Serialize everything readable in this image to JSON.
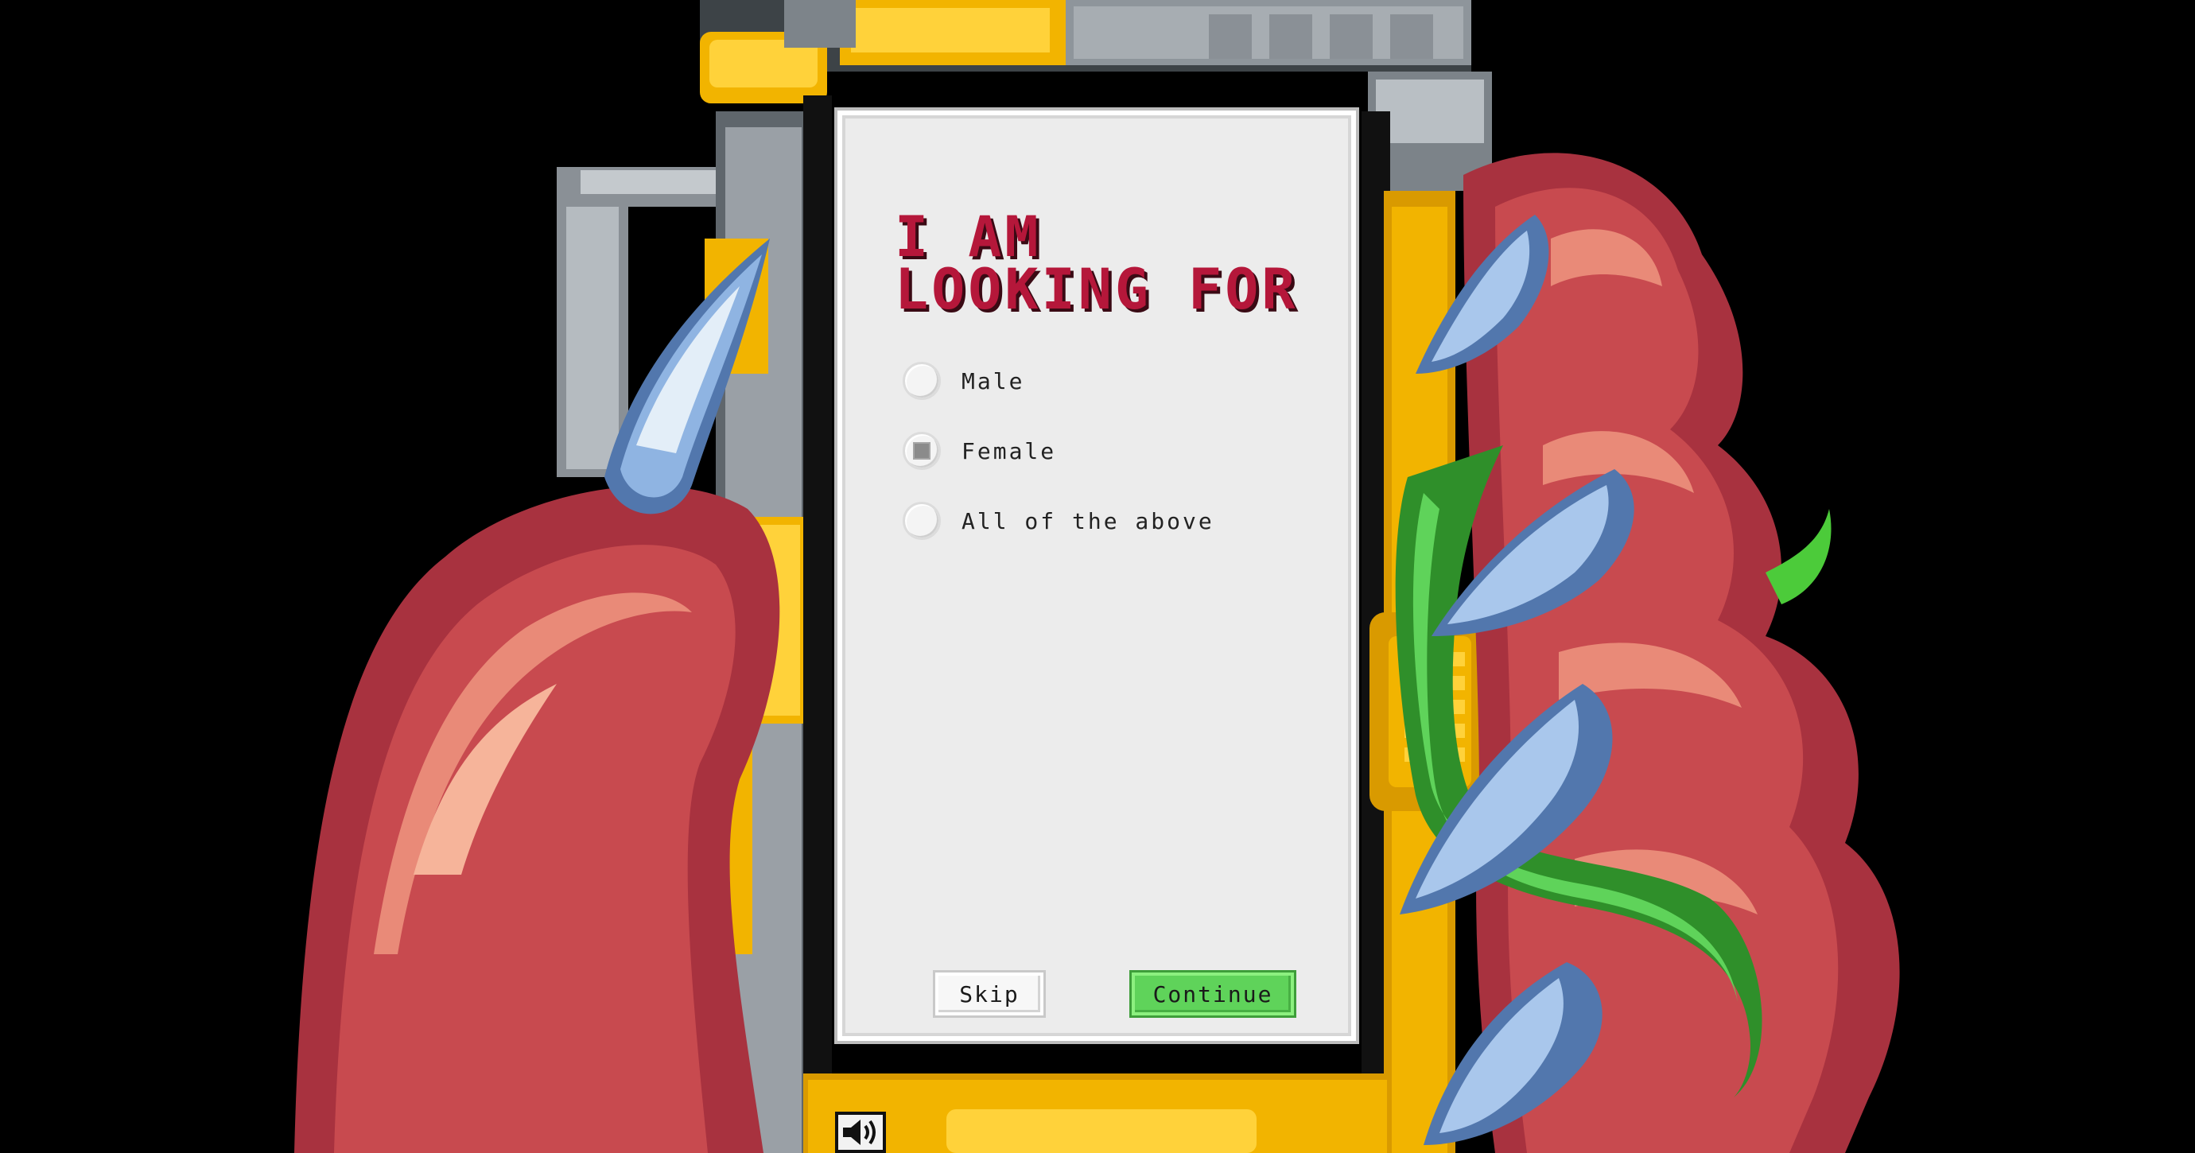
{
  "question": {
    "title": "I AM LOOKING FOR"
  },
  "options": [
    {
      "label": "Male",
      "selected": false
    },
    {
      "label": "Female",
      "selected": true
    },
    {
      "label": "All of the above",
      "selected": false
    }
  ],
  "buttons": {
    "skip_label": "Skip",
    "continue_label": "Continue"
  },
  "sound": {
    "icon": "speaker-icon"
  },
  "colors": {
    "background": "#000000",
    "title": "#b5173a",
    "panel": "#ececec",
    "continue": "#5fd35a",
    "fur": "#c84a4f",
    "claw": "#7fa4d4",
    "frame_yellow": "#f4b400",
    "metal": "#9aa0a6",
    "tentacle": "#4ccb3a"
  }
}
